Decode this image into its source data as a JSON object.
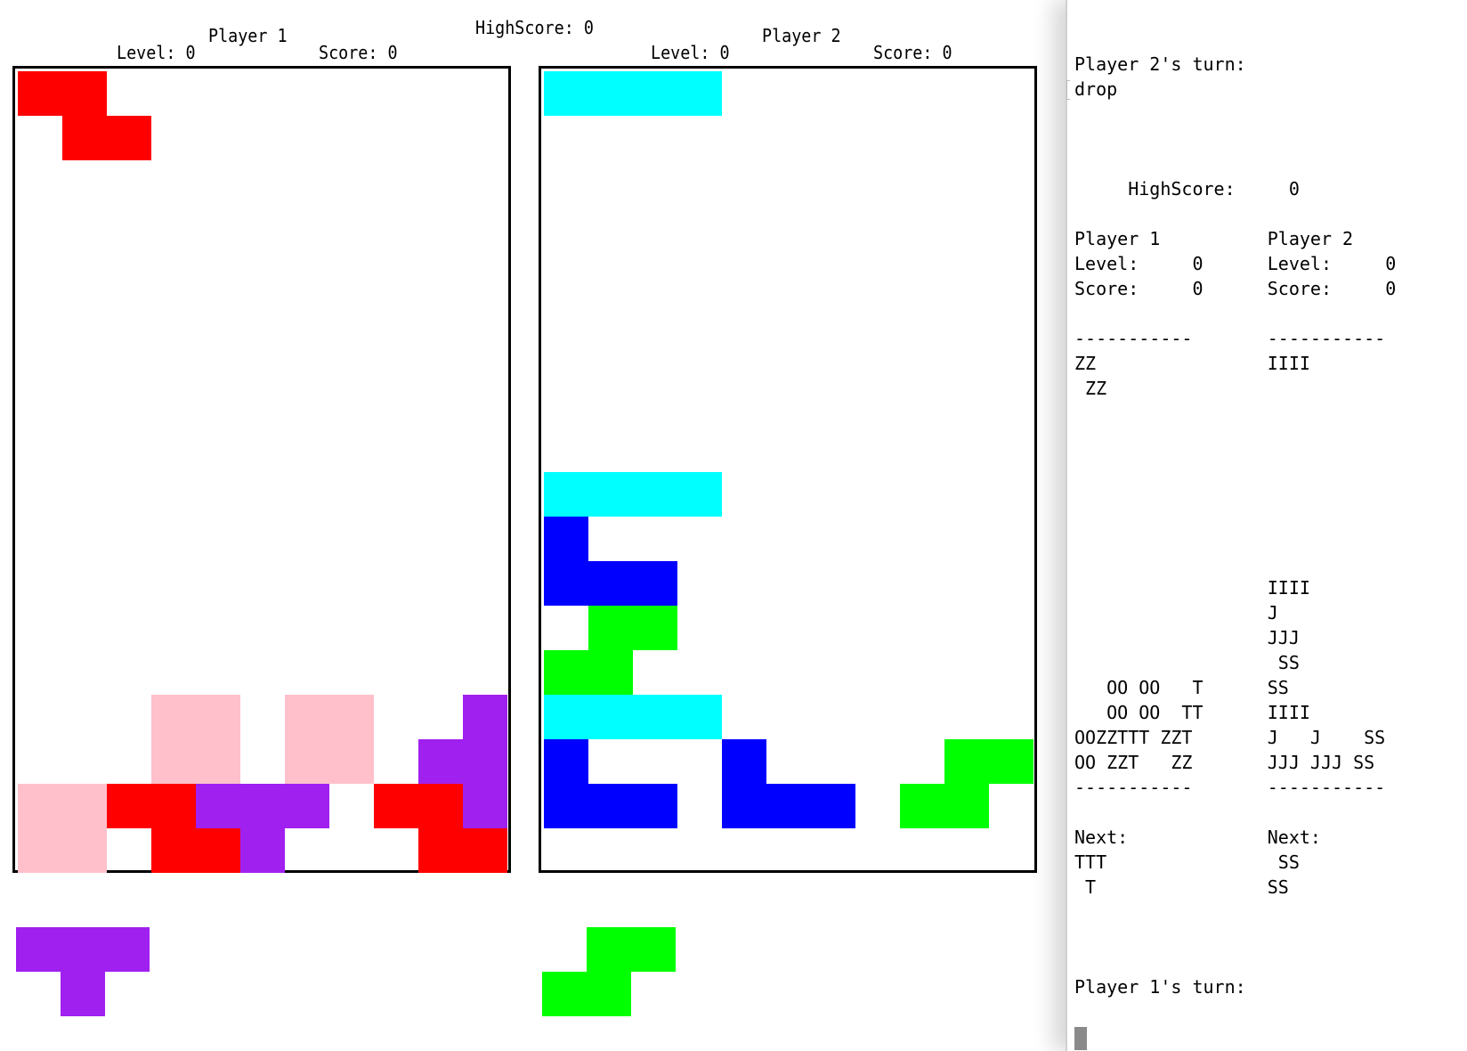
{
  "game": {
    "highscore_label": "HighScore: 0",
    "player1": {
      "name": "Player 1",
      "level_label": "Level: 0",
      "score_label": "Score: 0",
      "level": 0,
      "score": 0
    },
    "player2": {
      "name": "Player 2",
      "level_label": "Level: 0",
      "score_label": "Score: 0",
      "level": 0,
      "score": 0
    }
  },
  "colors": {
    "Z": "#ff0000",
    "I": "#00ffff",
    "J": "#0000ff",
    "S": "#00ff00",
    "T": "#a020f0",
    "O": "#ffc0cb"
  },
  "board1_rows": [
    "ZZ         ",
    " ZZ        ",
    "           ",
    "           ",
    "           ",
    "           ",
    "           ",
    "           ",
    "           ",
    "           ",
    "           ",
    "           ",
    "           ",
    "           ",
    "   OO OO  T",
    "   OO OO TT",
    "OOZZTTT ZZT",
    "OO ZZT   ZZ"
  ],
  "board2_rows": [
    "IIII       ",
    "           ",
    "           ",
    "           ",
    "           ",
    "           ",
    "           ",
    "           ",
    "           ",
    "IIII       ",
    "J          ",
    "JJJ        ",
    " SS        ",
    "SS         ",
    "IIII       ",
    "J   J    SS",
    "JJJ JJJ SS "
  ],
  "preview1_rows": [
    "TTT",
    " T "
  ],
  "preview2_rows": [
    " SS",
    "SS "
  ],
  "terminal": {
    "lines": [
      "Player 2's turn:",
      "drop",
      "",
      "",
      "",
      "     HighScore:     0",
      "",
      "Player 1          Player 2",
      "Level:     0      Level:     0",
      "Score:     0      Score:     0",
      "",
      "-----------       -----------",
      "ZZ                IIII",
      " ZZ",
      "",
      "",
      "",
      "",
      "",
      "",
      "",
      "                  IIII",
      "                  J",
      "                  JJJ",
      "                   SS",
      "   OO OO   T      SS",
      "   OO OO  TT      IIII",
      "OOZZTTT ZZT       J   J    SS",
      "OO ZZT   ZZ       JJJ JJJ SS",
      "-----------       -----------",
      "",
      "Next:             Next:",
      "TTT                SS",
      " T                SS",
      "",
      "",
      "",
      "Player 1's turn:"
    ]
  }
}
